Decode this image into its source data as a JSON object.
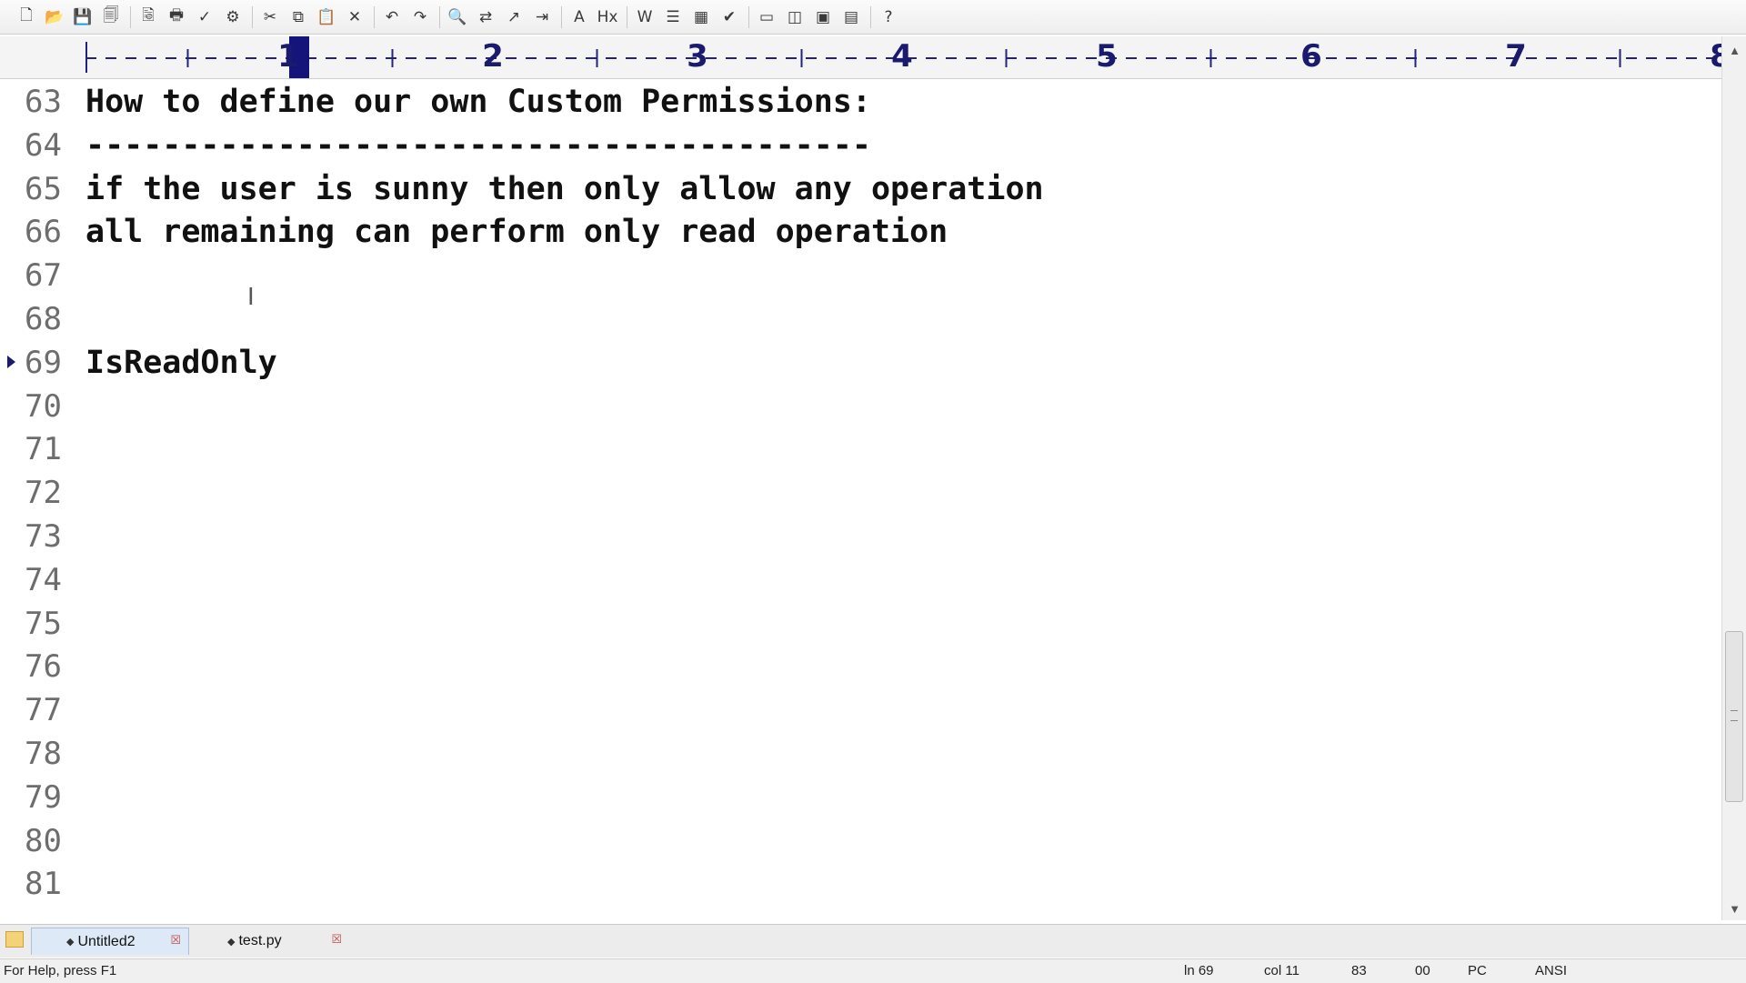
{
  "toolbar": {
    "icons": [
      "new-file-icon",
      "open-file-icon",
      "save-icon",
      "save-all-icon",
      "print-preview-icon",
      "print-icon",
      "spell-check-icon",
      "page-setup-icon",
      "cut-icon",
      "copy-icon",
      "paste-icon",
      "delete-icon",
      "undo-icon",
      "redo-icon",
      "find-icon",
      "replace-icon",
      "goto-icon",
      "indent-icon",
      "font-icon",
      "hex-icon",
      "word-wrap-icon",
      "list-icon",
      "column-icon",
      "check-icon",
      "window-icon",
      "split-icon",
      "monitor-icon",
      "document-icon",
      "help-icon"
    ],
    "glyphs": [
      "🗋",
      "📂",
      "💾",
      "🗐",
      "🗟",
      "🖶",
      "✓",
      "⚙",
      "✂",
      "⧉",
      "📋",
      "✕",
      "↶",
      "↷",
      "🔍",
      "⇄",
      "↗",
      "⇥",
      "A",
      "Hx",
      "W",
      "☰",
      "▦",
      "✔",
      "▭",
      "◫",
      "▣",
      "▤",
      "?"
    ]
  },
  "ruler": {
    "numbers": [
      "1",
      "2",
      "3",
      "4",
      "5",
      "6",
      "7",
      "8"
    ]
  },
  "editor": {
    "lines": [
      {
        "num": "63",
        "text": "How to define our own Custom Permissions:"
      },
      {
        "num": "64",
        "text": "-----------------------------------------"
      },
      {
        "num": "65",
        "text": "if the user is sunny then only allow any operation"
      },
      {
        "num": "66",
        "text": "all remaining can perform only read operation"
      },
      {
        "num": "67",
        "text": ""
      },
      {
        "num": "68",
        "text": ""
      },
      {
        "num": "69",
        "text": "IsReadOnly"
      },
      {
        "num": "70",
        "text": ""
      },
      {
        "num": "71",
        "text": ""
      },
      {
        "num": "72",
        "text": ""
      },
      {
        "num": "73",
        "text": ""
      },
      {
        "num": "74",
        "text": ""
      },
      {
        "num": "75",
        "text": ""
      },
      {
        "num": "76",
        "text": ""
      },
      {
        "num": "77",
        "text": ""
      },
      {
        "num": "78",
        "text": ""
      },
      {
        "num": "79",
        "text": ""
      },
      {
        "num": "80",
        "text": ""
      },
      {
        "num": "81",
        "text": ""
      }
    ],
    "current_line": "69"
  },
  "tabs": {
    "active_label": "Untitled2",
    "inactive_label": "test.py"
  },
  "status": {
    "help": "For Help, press F1",
    "line": "ln 69",
    "col": "col 11",
    "count": "83",
    "code": "00",
    "mode": "PC",
    "encoding": "ANSI"
  },
  "colors": {
    "ruler_accent": "#1a1a6e",
    "cursor_block": "#14147a"
  }
}
